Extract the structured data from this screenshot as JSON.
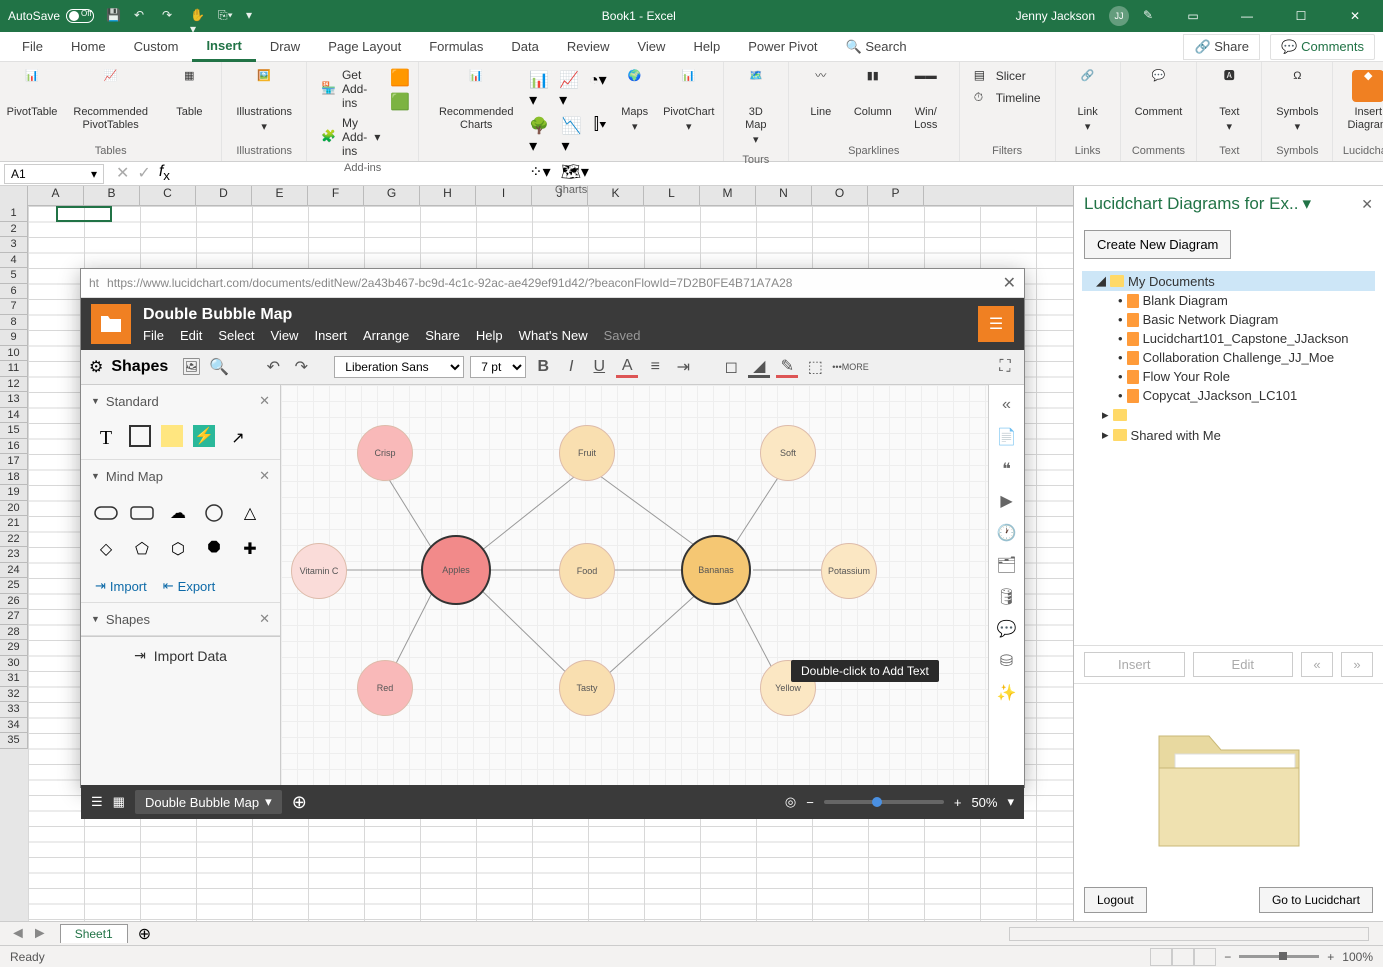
{
  "titlebar": {
    "autosave_label": "AutoSave",
    "autosave_state": "Off",
    "doc_title": "Book1 - Excel",
    "user_name": "Jenny Jackson",
    "user_initials": "JJ"
  },
  "tabs": {
    "file": "File",
    "home": "Home",
    "custom": "Custom",
    "insert": "Insert",
    "draw": "Draw",
    "page_layout": "Page Layout",
    "formulas": "Formulas",
    "data": "Data",
    "review": "Review",
    "view": "View",
    "help": "Help",
    "power_pivot": "Power Pivot",
    "search": "Search",
    "share": "Share",
    "comments": "Comments"
  },
  "ribbon": {
    "tables": {
      "label": "Tables",
      "pivottable": "PivotTable",
      "recommended": "Recommended PivotTables",
      "table": "Table"
    },
    "illustrations": {
      "label": "Illustrations",
      "btn": "Illustrations"
    },
    "addins": {
      "label": "Add-ins",
      "get": "Get Add-ins",
      "my": "My Add-ins"
    },
    "charts": {
      "label": "Charts",
      "recommended": "Recommended Charts",
      "maps": "Maps",
      "pivotchart": "PivotChart"
    },
    "tours": {
      "label": "Tours",
      "map3d": "3D Map"
    },
    "sparklines": {
      "label": "Sparklines",
      "line": "Line",
      "column": "Column",
      "winloss": "Win/ Loss"
    },
    "filters": {
      "label": "Filters",
      "slicer": "Slicer",
      "timeline": "Timeline"
    },
    "links": {
      "label": "Links",
      "link": "Link"
    },
    "comments": {
      "label": "Comments",
      "comment": "Comment"
    },
    "text": {
      "label": "Text",
      "btn": "Text"
    },
    "symbols": {
      "label": "Symbols",
      "btn": "Symbols"
    },
    "lucidchart": {
      "label": "Lucidchart",
      "insert": "Insert Diagram"
    }
  },
  "namebox": {
    "value": "A1"
  },
  "columns": [
    "A",
    "B",
    "C",
    "D",
    "E",
    "F",
    "G",
    "H",
    "I",
    "J",
    "K",
    "L",
    "M",
    "N",
    "O",
    "P"
  ],
  "rows_count": 35,
  "lucidwin": {
    "url": "https://www.lucidchart.com/documents/editNew/2a43b467-bc9d-4c1c-92ac-ae429ef91d42/?beaconFlowId=7D2B0FE4B71A7A28",
    "title": "Double Bubble Map",
    "menu": {
      "file": "File",
      "edit": "Edit",
      "select": "Select",
      "view": "View",
      "insert": "Insert",
      "arrange": "Arrange",
      "share": "Share",
      "help": "Help",
      "whatsnew": "What's New",
      "saved": "Saved"
    },
    "font": "Liberation Sans",
    "fontsize": "7 pt",
    "more": "MORE",
    "sidebar": {
      "shapes_label": "Shapes",
      "standard": "Standard",
      "mindmap": "Mind Map",
      "shapes2": "Shapes",
      "import": "Import",
      "export": "Export",
      "import_data": "Import Data"
    },
    "bubbles": {
      "apples": "Apples",
      "bananas": "Bananas",
      "vitaminc": "Vitamin C",
      "crisp": "Crisp",
      "fruit": "Fruit",
      "food": "Food",
      "tasty": "Tasty",
      "red": "Red",
      "soft": "Soft",
      "potassium": "Potassium",
      "yellow": "Yellow"
    },
    "tooltip": "Double-click to Add Text",
    "page_name": "Double Bubble Map",
    "zoom": "50%"
  },
  "rightpanel": {
    "title": "Lucidchart Diagrams for Ex..",
    "create_btn": "Create New Diagram",
    "tree": {
      "my_docs": "My Documents",
      "items": [
        "Blank Diagram",
        "Basic Network Diagram",
        "Lucidchart101_Capstone_JJackson",
        "Collaboration Challenge_JJ_Moe",
        "Flow Your Role",
        "Copycat_JJackson_LC101"
      ],
      "shared": "Shared with Me"
    },
    "insert": "Insert",
    "edit": "Edit",
    "nav_prev": "«",
    "nav_next": "»",
    "logout": "Logout",
    "goto": "Go to Lucidchart"
  },
  "sheet_tabs": {
    "sheet1": "Sheet1"
  },
  "statusbar": {
    "ready": "Ready",
    "zoom": "100%"
  }
}
